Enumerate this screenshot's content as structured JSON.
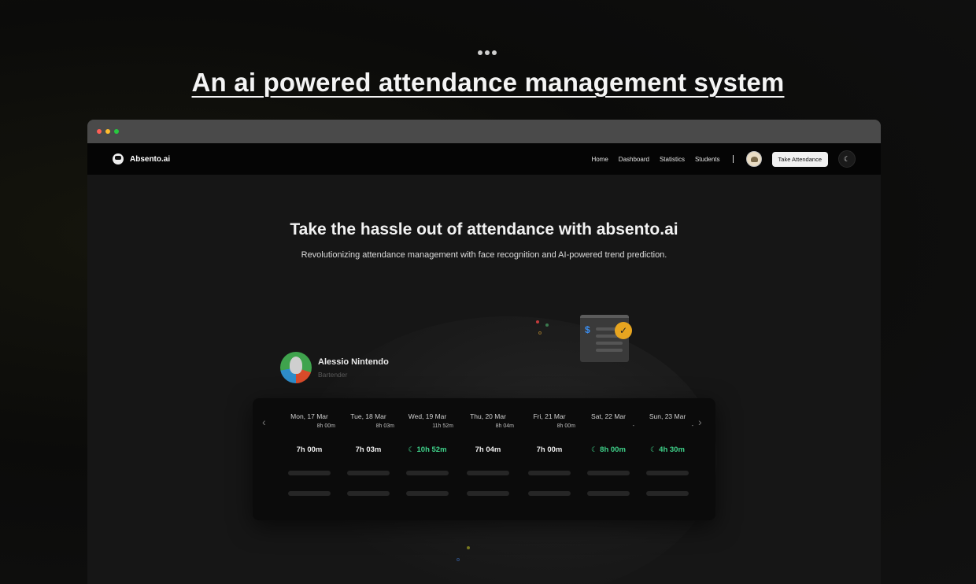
{
  "headline": "An ai powered attendance management system",
  "browser": {
    "traffic_lights": [
      "#ff5f56",
      "#ffbd2e",
      "#27c93f"
    ]
  },
  "navbar": {
    "brand": "Absento.ai",
    "links": [
      "Home",
      "Dashboard",
      "Statistics",
      "Students"
    ],
    "cta": "Take Attendance"
  },
  "hero": {
    "title": "Take the hassle out of attendance with absento.ai",
    "subtitle": "Revolutionizing attendance management with face recognition and AI-powered trend prediction."
  },
  "person": {
    "name": "Alessio Nintendo",
    "role": "Bartender"
  },
  "schedule": {
    "days": [
      {
        "label": "Mon, 17 Mar",
        "sub": "8h 00m",
        "total": "7h 00m",
        "night": false
      },
      {
        "label": "Tue, 18 Mar",
        "sub": "8h 03m",
        "total": "7h 03m",
        "night": false
      },
      {
        "label": "Wed, 19 Mar",
        "sub": "11h 52m",
        "total": "10h 52m",
        "night": true
      },
      {
        "label": "Thu, 20 Mar",
        "sub": "8h 04m",
        "total": "7h 04m",
        "night": false
      },
      {
        "label": "Fri, 21 Mar",
        "sub": "8h 00m",
        "total": "7h 00m",
        "night": false
      },
      {
        "label": "Sat, 22 Mar",
        "sub": "-",
        "total": "8h 00m",
        "night": true
      },
      {
        "label": "Sun, 23 Mar",
        "sub": "-",
        "total": "4h 30m",
        "night": true
      }
    ]
  },
  "colors": {
    "accent_green": "#3fd28a",
    "check_badge": "#e7a520"
  }
}
